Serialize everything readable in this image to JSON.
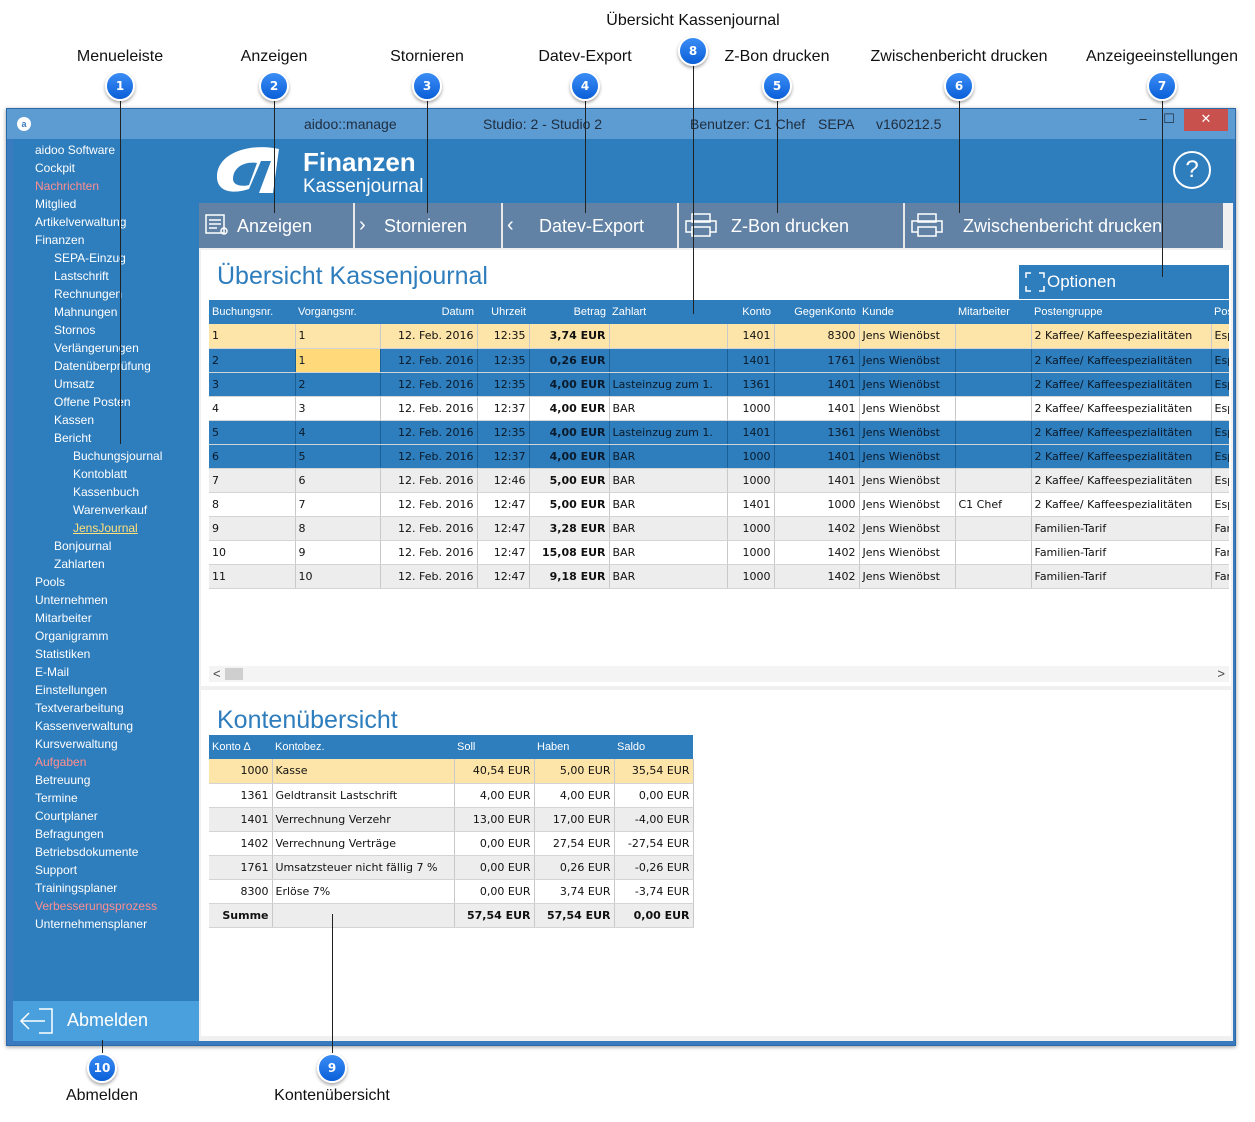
{
  "callouts": [
    {
      "num": "1",
      "label": "Menueleiste"
    },
    {
      "num": "2",
      "label": "Anzeigen"
    },
    {
      "num": "3",
      "label": "Stornieren"
    },
    {
      "num": "4",
      "label": "Datev-Export"
    },
    {
      "num": "5",
      "label": "Z-Bon drucken"
    },
    {
      "num": "6",
      "label": "Zwischenbericht drucken"
    },
    {
      "num": "7",
      "label": "Anzeigeeinstellungen"
    },
    {
      "num": "8",
      "label": "Übersicht Kassenjournal"
    },
    {
      "num": "9",
      "label": "Kontenübersicht"
    },
    {
      "num": "10",
      "label": "Abmelden"
    }
  ],
  "window": {
    "app": "aidoo::manage",
    "studio": "Studio: 2 - Studio 2",
    "user": "Benutzer: C1 Chef",
    "mode": "SEPA",
    "version": "v160212.5",
    "minimize": "–",
    "maximize": "☐",
    "close": "✕"
  },
  "sidebar": {
    "items": [
      {
        "label": "aidoo Software",
        "level": 0,
        "style": "normal"
      },
      {
        "label": "Cockpit",
        "level": 0,
        "style": "normal"
      },
      {
        "label": "Nachrichten",
        "level": 0,
        "style": "red"
      },
      {
        "label": "Mitglied",
        "level": 0,
        "style": "normal"
      },
      {
        "label": "Artikelverwaltung",
        "level": 0,
        "style": "normal"
      },
      {
        "label": "Finanzen",
        "level": 0,
        "style": "normal"
      },
      {
        "label": "SEPA-Einzug",
        "level": 1,
        "style": "normal"
      },
      {
        "label": "Lastschrift",
        "level": 1,
        "style": "normal"
      },
      {
        "label": "Rechnungen",
        "level": 1,
        "style": "normal"
      },
      {
        "label": "Mahnungen",
        "level": 1,
        "style": "normal"
      },
      {
        "label": "Stornos",
        "level": 1,
        "style": "normal"
      },
      {
        "label": "Verlängerungen",
        "level": 1,
        "style": "normal"
      },
      {
        "label": "Datenüberprüfung",
        "level": 1,
        "style": "normal"
      },
      {
        "label": "Umsatz",
        "level": 1,
        "style": "normal"
      },
      {
        "label": "Offene Posten",
        "level": 1,
        "style": "normal"
      },
      {
        "label": "Kassen",
        "level": 1,
        "style": "normal"
      },
      {
        "label": "Bericht",
        "level": 1,
        "style": "normal"
      },
      {
        "label": "Buchungsjournal",
        "level": 2,
        "style": "normal"
      },
      {
        "label": "Kontoblatt",
        "level": 2,
        "style": "normal"
      },
      {
        "label": "Kassenbuch",
        "level": 2,
        "style": "normal"
      },
      {
        "label": "Warenverkauf",
        "level": 2,
        "style": "normal"
      },
      {
        "label": "JensJournal",
        "level": 2,
        "style": "active"
      },
      {
        "label": "Bonjournal",
        "level": 1,
        "style": "normal"
      },
      {
        "label": "Zahlarten",
        "level": 1,
        "style": "normal"
      },
      {
        "label": "Pools",
        "level": 0,
        "style": "normal"
      },
      {
        "label": "Unternehmen",
        "level": 0,
        "style": "normal"
      },
      {
        "label": "Mitarbeiter",
        "level": 0,
        "style": "normal"
      },
      {
        "label": "Organigramm",
        "level": 0,
        "style": "normal"
      },
      {
        "label": "Statistiken",
        "level": 0,
        "style": "normal"
      },
      {
        "label": "E-Mail",
        "level": 0,
        "style": "normal"
      },
      {
        "label": "Einstellungen",
        "level": 0,
        "style": "normal"
      },
      {
        "label": "Textverarbeitung",
        "level": 0,
        "style": "normal"
      },
      {
        "label": "Kassenverwaltung",
        "level": 0,
        "style": "normal"
      },
      {
        "label": "Kursverwaltung",
        "level": 0,
        "style": "normal"
      },
      {
        "label": "Aufgaben",
        "level": 0,
        "style": "red"
      },
      {
        "label": "Betreuung",
        "level": 0,
        "style": "normal"
      },
      {
        "label": "Termine",
        "level": 0,
        "style": "normal"
      },
      {
        "label": "Courtplaner",
        "level": 0,
        "style": "normal"
      },
      {
        "label": "Befragungen",
        "level": 0,
        "style": "normal"
      },
      {
        "label": "Betriebsdokumente",
        "level": 0,
        "style": "normal"
      },
      {
        "label": "Support",
        "level": 0,
        "style": "normal"
      },
      {
        "label": "Trainingsplaner",
        "level": 0,
        "style": "normal"
      },
      {
        "label": "Verbesserungsprozess",
        "level": 0,
        "style": "red"
      },
      {
        "label": "Unternehmensplaner",
        "level": 0,
        "style": "normal"
      }
    ],
    "logout_label": "Abmelden"
  },
  "header": {
    "title": "Finanzen",
    "subtitle": "Kassenjournal",
    "help": "?"
  },
  "toolbar": {
    "buttons": [
      {
        "label": "Anzeigen",
        "icon": "list-icon"
      },
      {
        "label": "Stornieren",
        "icon": "chevron-right-icon"
      },
      {
        "label": "Datev-Export",
        "icon": "chevron-left-icon"
      },
      {
        "label": "Z-Bon drucken",
        "icon": "printer-icon"
      },
      {
        "label": "Zwischenbericht drucken",
        "icon": "printer-icon"
      }
    ]
  },
  "journal": {
    "title": "Übersicht Kassenjournal",
    "options_label": "Optionen",
    "columns": [
      "Buchungsnr.",
      "Vorgangsnr.",
      "Datum",
      "Uhrzeit",
      "Betrag",
      "Zahlart",
      "Konto",
      "GegenKonto",
      "Kunde",
      "Mitarbeiter",
      "Postengruppe",
      "Pos"
    ],
    "rows": [
      {
        "state": "hl",
        "cells": [
          "1",
          "1",
          "12. Feb. 2016",
          "12:35",
          "3,74 EUR",
          "",
          "1401",
          "8300",
          "Jens Wienöbst",
          "",
          "2 Kaffee/ Kaffeespezialitäten",
          "Esp"
        ]
      },
      {
        "state": "sel",
        "cells": [
          "2",
          "1",
          "12. Feb. 2016",
          "12:35",
          "0,26 EUR",
          "",
          "1401",
          "1761",
          "Jens Wienöbst",
          "",
          "2 Kaffee/ Kaffeespezialitäten",
          "Esp"
        ]
      },
      {
        "state": "sel",
        "cells": [
          "3",
          "2",
          "12. Feb. 2016",
          "12:35",
          "4,00 EUR",
          "Lasteinzug zum 1.",
          "1361",
          "1401",
          "Jens Wienöbst",
          "",
          "2 Kaffee/ Kaffeespezialitäten",
          "Esp"
        ]
      },
      {
        "state": "wht",
        "cells": [
          "4",
          "3",
          "12. Feb. 2016",
          "12:37",
          "4,00 EUR",
          "BAR",
          "1000",
          "1401",
          "Jens Wienöbst",
          "",
          "2 Kaffee/ Kaffeespezialitäten",
          "Esp"
        ]
      },
      {
        "state": "sel",
        "cells": [
          "5",
          "4",
          "12. Feb. 2016",
          "12:35",
          "4,00 EUR",
          "Lasteinzug zum 1.",
          "1401",
          "1361",
          "Jens Wienöbst",
          "",
          "2 Kaffee/ Kaffeespezialitäten",
          "Esp"
        ]
      },
      {
        "state": "sel",
        "cells": [
          "6",
          "5",
          "12. Feb. 2016",
          "12:37",
          "4,00 EUR",
          "BAR",
          "1000",
          "1401",
          "Jens Wienöbst",
          "",
          "2 Kaffee/ Kaffeespezialitäten",
          "Esp"
        ]
      },
      {
        "state": "alt",
        "cells": [
          "7",
          "6",
          "12. Feb. 2016",
          "12:46",
          "5,00 EUR",
          "BAR",
          "1000",
          "1401",
          "Jens Wienöbst",
          "",
          "2 Kaffee/ Kaffeespezialitäten",
          "Esp"
        ]
      },
      {
        "state": "wht",
        "cells": [
          "8",
          "7",
          "12. Feb. 2016",
          "12:47",
          "5,00 EUR",
          "BAR",
          "1401",
          "1000",
          "Jens Wienöbst",
          "C1 Chef",
          "2 Kaffee/ Kaffeespezialitäten",
          "Esp"
        ]
      },
      {
        "state": "alt",
        "cells": [
          "9",
          "8",
          "12. Feb. 2016",
          "12:47",
          "3,28 EUR",
          "BAR",
          "1000",
          "1402",
          "Jens Wienöbst",
          "",
          "Familien-Tarif",
          "Far"
        ]
      },
      {
        "state": "wht",
        "cells": [
          "10",
          "9",
          "12. Feb. 2016",
          "12:47",
          "15,08 EUR",
          "BAR",
          "1000",
          "1402",
          "Jens Wienöbst",
          "",
          "Familien-Tarif",
          "Far"
        ]
      },
      {
        "state": "alt",
        "cells": [
          "11",
          "10",
          "12. Feb. 2016",
          "12:47",
          "9,18 EUR",
          "BAR",
          "1000",
          "1402",
          "Jens Wienöbst",
          "",
          "Familien-Tarif",
          "Far"
        ]
      }
    ],
    "scroll_left": "<",
    "scroll_right": ">"
  },
  "accounts": {
    "title": "Kontenübersicht",
    "columns": [
      "Konto ∆",
      "Kontobez.",
      "Soll",
      "Haben",
      "Saldo"
    ],
    "rows": [
      {
        "state": "hl",
        "cells": [
          "1000",
          "Kasse",
          "40,54 EUR",
          "5,00 EUR",
          "35,54 EUR"
        ]
      },
      {
        "state": "wht",
        "cells": [
          "1361",
          "Geldtransit Lastschrift",
          "4,00 EUR",
          "4,00 EUR",
          "0,00 EUR"
        ]
      },
      {
        "state": "alt",
        "cells": [
          "1401",
          "Verrechnung Verzehr",
          "13,00 EUR",
          "17,00 EUR",
          "-4,00 EUR"
        ]
      },
      {
        "state": "wht",
        "cells": [
          "1402",
          "Verrechnung Verträge",
          "0,00 EUR",
          "27,54 EUR",
          "-27,54 EUR"
        ]
      },
      {
        "state": "alt",
        "cells": [
          "1761",
          "Umsatzsteuer nicht fällig 7 %",
          "0,00 EUR",
          "0,26 EUR",
          "-0,26 EUR"
        ]
      },
      {
        "state": "wht",
        "cells": [
          "8300",
          "Erlöse 7%",
          "0,00 EUR",
          "3,74 EUR",
          "-3,74 EUR"
        ]
      },
      {
        "state": "alt",
        "cells": [
          "Summe",
          "",
          "57,54 EUR",
          "57,54 EUR",
          "0,00 EUR"
        ]
      }
    ]
  }
}
